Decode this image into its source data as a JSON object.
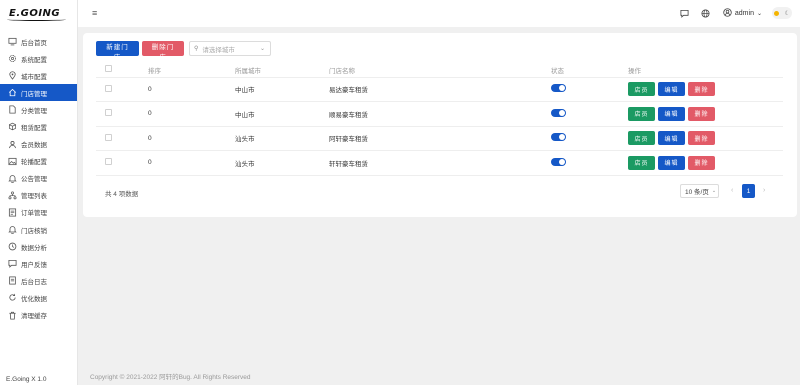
{
  "app": {
    "logo": "E.GOING",
    "version": "E.Going X 1.0"
  },
  "sidebar": {
    "items": [
      {
        "label": "后台首页",
        "icon": "monitor-icon"
      },
      {
        "label": "系统配置",
        "icon": "gear-icon"
      },
      {
        "label": "城市配置",
        "icon": "location-icon"
      },
      {
        "label": "门店管理",
        "icon": "home-icon"
      },
      {
        "label": "分类管理",
        "icon": "file-icon"
      },
      {
        "label": "租赁配置",
        "icon": "box-icon"
      },
      {
        "label": "会员数据",
        "icon": "user-icon"
      },
      {
        "label": "轮播配置",
        "icon": "image-icon"
      },
      {
        "label": "公告管理",
        "icon": "bell-icon"
      },
      {
        "label": "管理列表",
        "icon": "org-icon"
      },
      {
        "label": "订单管理",
        "icon": "list-icon"
      },
      {
        "label": "门店核销",
        "icon": "bell-icon"
      },
      {
        "label": "数据分析",
        "icon": "clock-icon"
      },
      {
        "label": "用户反馈",
        "icon": "chat-icon"
      },
      {
        "label": "后台日志",
        "icon": "document-icon"
      },
      {
        "label": "优化数据",
        "icon": "refresh-icon"
      },
      {
        "label": "清理缓存",
        "icon": "trash-icon"
      }
    ],
    "active_index": 3
  },
  "header": {
    "user": "admin"
  },
  "toolbar": {
    "add_label": "新建门店",
    "delete_label": "删除门店",
    "city_placeholder": "请选择城市"
  },
  "table": {
    "headers": [
      "",
      "排序",
      "所属城市",
      "门店名称",
      "状态",
      "操作"
    ],
    "rows": [
      {
        "sort": "0",
        "city": "中山市",
        "name": "易达豪车租赁",
        "enabled": true
      },
      {
        "sort": "0",
        "city": "中山市",
        "name": "顺易豪车租赁",
        "enabled": true
      },
      {
        "sort": "0",
        "city": "汕头市",
        "name": "阿轩豪车租赁",
        "enabled": true
      },
      {
        "sort": "0",
        "city": "汕头市",
        "name": "轩轩豪车租赁",
        "enabled": true
      }
    ],
    "actions": {
      "staff": "店员",
      "edit": "编辑",
      "delete": "删除"
    }
  },
  "pagination": {
    "total": "共 4 项数据",
    "page_size": "10 条/页",
    "current": "1",
    "prev": "‹",
    "next": "›"
  },
  "footer": {
    "copyright": "Copyright © 2021-2022 阿轩的Bug. All Rights Reserved"
  },
  "colors": {
    "primary": "#1558c7",
    "danger": "#e25a67",
    "success": "#1b9a63"
  }
}
